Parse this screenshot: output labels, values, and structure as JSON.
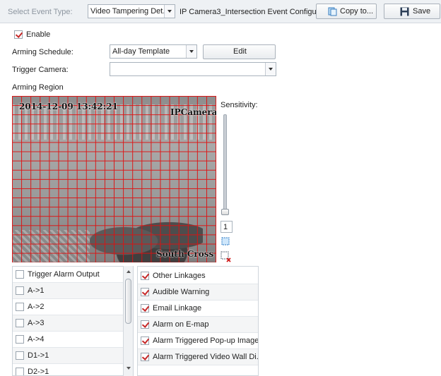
{
  "toolbar": {
    "select_event_type_label": "Select Event Type:",
    "event_type_value": "Video Tampering Det...",
    "camera_title": "IP Camera3_Intersection Event Configu...",
    "copy_label": "Copy to...",
    "save_label": "Save"
  },
  "enable": {
    "label": "Enable",
    "checked": true
  },
  "arming_schedule": {
    "label": "Arming Schedule:",
    "value": "All-day Template",
    "edit_label": "Edit"
  },
  "trigger_camera": {
    "label": "Trigger Camera:",
    "value": ""
  },
  "arming_region": {
    "label": "Arming Region",
    "osd_timestamp": "2014-12-09 13:42:21",
    "osd_camera": "IPCamera",
    "osd_location": "South Cross",
    "sensitivity_label": "Sensitivity:",
    "sensitivity_value": "1"
  },
  "alarm_outputs": [
    {
      "label": "Trigger Alarm Output",
      "checked": false
    },
    {
      "label": "A->1",
      "checked": false
    },
    {
      "label": "A->2",
      "checked": false
    },
    {
      "label": "A->3",
      "checked": false
    },
    {
      "label": "A->4",
      "checked": false
    },
    {
      "label": "D1->1",
      "checked": false
    },
    {
      "label": "D2->1",
      "checked": false
    }
  ],
  "linkages": [
    {
      "label": "Other Linkages",
      "checked": true
    },
    {
      "label": "Audible Warning",
      "checked": true
    },
    {
      "label": "Email Linkage",
      "checked": true
    },
    {
      "label": "Alarm on E-map",
      "checked": true
    },
    {
      "label": "Alarm Triggered Pop-up Image",
      "checked": true
    },
    {
      "label": "Alarm Triggered Video Wall Di...",
      "checked": true
    }
  ],
  "colors": {
    "grid": "#e01010",
    "check": "#c62828",
    "toolbar_bg": "#eef1f4"
  }
}
